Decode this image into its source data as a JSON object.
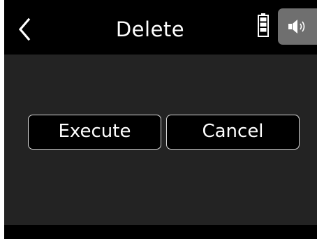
{
  "header": {
    "title": "Delete",
    "back_icon": "chevron-left-icon",
    "battery_icon": "battery-full-icon",
    "speaker_icon": "speaker-volume-icon"
  },
  "dialog": {
    "execute_label": "Execute",
    "cancel_label": "Cancel"
  },
  "colors": {
    "background": "#000000",
    "body_background": "#232323",
    "button_border": "#d8d8d8",
    "speaker_button": "#6f6f6f",
    "text": "#ffffff"
  }
}
